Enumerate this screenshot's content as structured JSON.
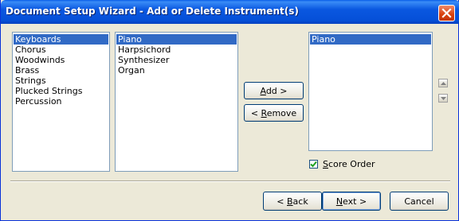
{
  "window": {
    "title": "Document Setup Wizard - Add or Delete Instrument(s)"
  },
  "families": {
    "items": [
      "Keyboards",
      "Chorus",
      "Woodwinds",
      "Brass",
      "Strings",
      "Plucked Strings",
      "Percussion"
    ],
    "selected_index": 0
  },
  "instruments": {
    "items": [
      "Piano",
      "Harpsichord",
      "Synthesizer",
      "Organ"
    ],
    "selected_index": 0
  },
  "score": {
    "items": [
      "Piano"
    ],
    "selected_index": 0
  },
  "buttons": {
    "add": {
      "pre": "",
      "ul": "A",
      "post": "dd >"
    },
    "remove": {
      "pre": "< ",
      "ul": "R",
      "post": "emove"
    },
    "back": {
      "pre": "< ",
      "ul": "B",
      "post": "ack"
    },
    "next": {
      "pre": "",
      "ul": "N",
      "post": "ext >"
    },
    "cancel": "Cancel"
  },
  "score_order": {
    "checked": true,
    "label_ul": "S",
    "label_rest": "core Order"
  },
  "colors": {
    "title_bar": "#0a57e0",
    "selection": "#316ac5",
    "close_button": "#d8400c"
  }
}
